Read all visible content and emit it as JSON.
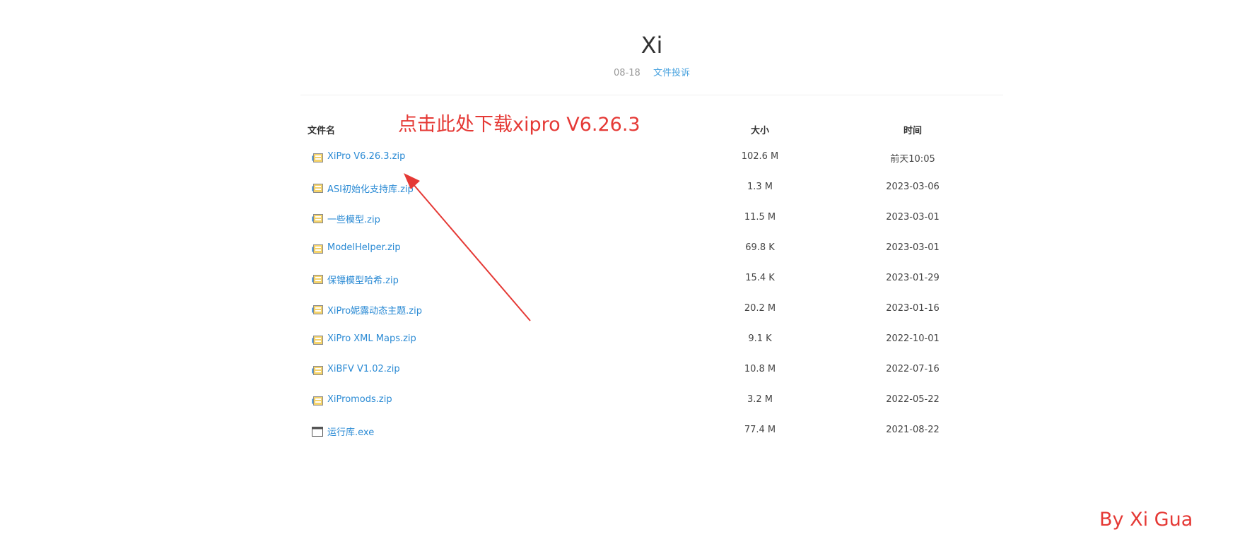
{
  "header": {
    "title": "Xi",
    "date": "08-18",
    "report_link": "文件投诉"
  },
  "table": {
    "columns": {
      "name": "文件名",
      "size": "大小",
      "time": "时间"
    },
    "rows": [
      {
        "icon": "zip-file-icon",
        "name": "XiPro V6.26.3.zip",
        "size": "102.6 M",
        "time": "前天10:05"
      },
      {
        "icon": "zip-file-icon",
        "name": "ASI初始化支持库.zip",
        "size": "1.3 M",
        "time": "2023-03-06"
      },
      {
        "icon": "zip-file-icon",
        "name": "一些模型.zip",
        "size": "11.5 M",
        "time": "2023-03-01"
      },
      {
        "icon": "zip-file-icon",
        "name": "ModelHelper.zip",
        "size": "69.8 K",
        "time": "2023-03-01"
      },
      {
        "icon": "zip-file-icon",
        "name": "保镖模型哈希.zip",
        "size": "15.4 K",
        "time": "2023-01-29"
      },
      {
        "icon": "zip-file-icon",
        "name": "XiPro妮露动态主题.zip",
        "size": "20.2 M",
        "time": "2023-01-16"
      },
      {
        "icon": "zip-file-icon",
        "name": "XiPro XML Maps.zip",
        "size": "9.1 K",
        "time": "2022-10-01"
      },
      {
        "icon": "zip-file-icon",
        "name": "XiBFV V1.02.zip",
        "size": "10.8 M",
        "time": "2022-07-16"
      },
      {
        "icon": "zip-file-icon",
        "name": "XiPromods.zip",
        "size": "3.2 M",
        "time": "2022-05-22"
      },
      {
        "icon": "exe-file-icon",
        "name": "运行库.exe",
        "size": "77.4 M",
        "time": "2021-08-22"
      }
    ]
  },
  "annotation": {
    "text": "点击此处下载xipro V6.26.3",
    "color": "#e53935"
  },
  "watermark": "By Xi Gua",
  "colors": {
    "link": "#2a8ad4",
    "accent_red": "#e53935",
    "muted": "#999999"
  }
}
